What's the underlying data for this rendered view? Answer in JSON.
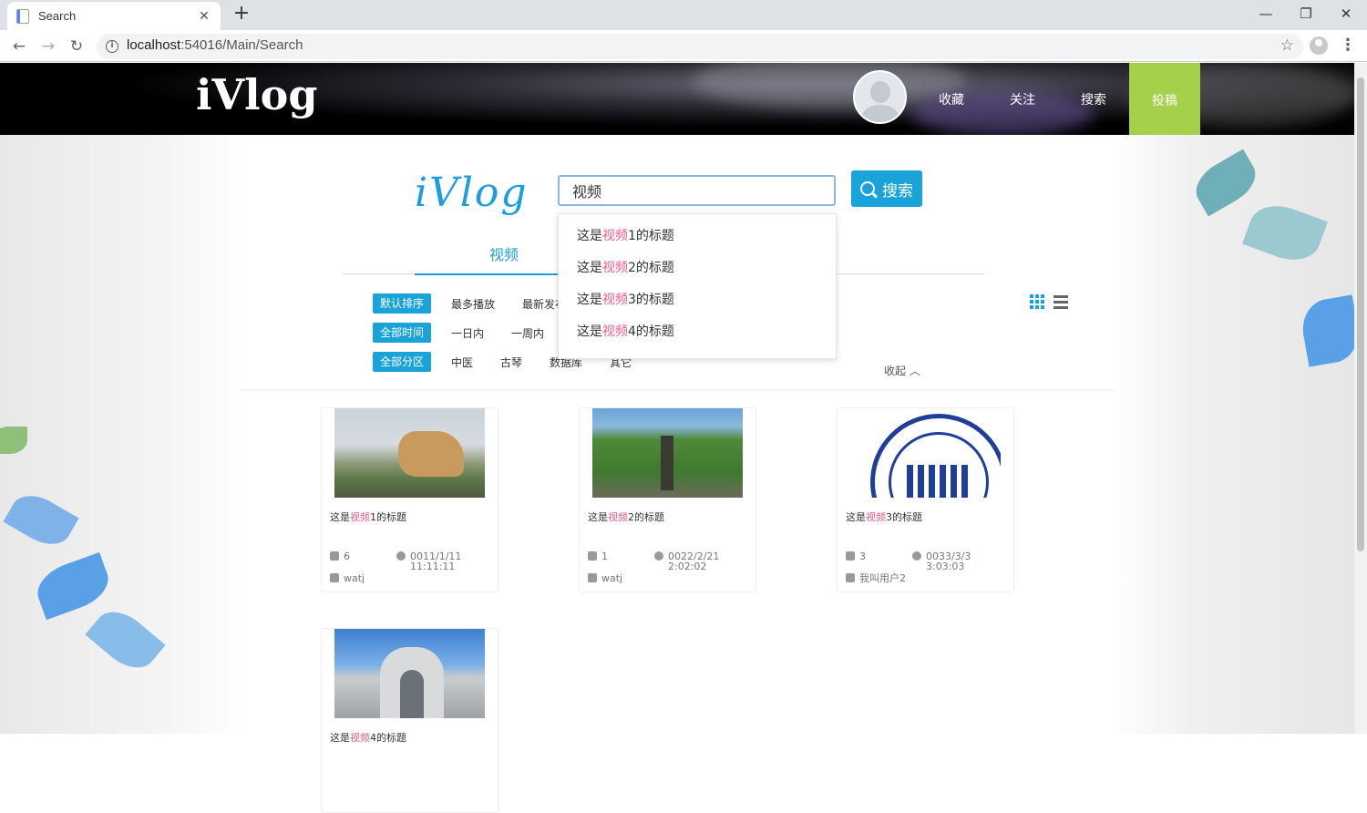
{
  "browser": {
    "tab_title": "Search",
    "tab_close": "✕",
    "new_tab": "+",
    "url_host": "localhost",
    "url_rest": ":54016/Main/Search",
    "win_min": "—",
    "win_max": "❐",
    "win_close": "✕"
  },
  "header": {
    "logo": "iVlog",
    "nav": [
      "收藏",
      "关注",
      "搜索"
    ],
    "submit": "投稿"
  },
  "search": {
    "logo": "iVlog",
    "query": "视频",
    "button": "搜索",
    "suggestions": [
      {
        "pre": "这是",
        "hl": "视频",
        "post": "1的标题"
      },
      {
        "pre": "这是",
        "hl": "视频",
        "post": "2的标题"
      },
      {
        "pre": "这是",
        "hl": "视频",
        "post": "3的标题"
      },
      {
        "pre": "这是",
        "hl": "视频",
        "post": "4的标题"
      }
    ]
  },
  "tabs": {
    "video": "视频"
  },
  "filters": {
    "sort": {
      "active": "默认排序",
      "options": [
        "最多播放",
        "最新发布"
      ]
    },
    "time": {
      "active": "全部时间",
      "options": [
        "一日内",
        "一周内"
      ]
    },
    "zone": {
      "active": "全部分区",
      "options": [
        "中医",
        "古琴",
        "数据库",
        "其它"
      ]
    },
    "collapse": "收起"
  },
  "results": [
    {
      "pre": "这是",
      "hl": "视频",
      "post": "1的标题",
      "plays": "6",
      "date": "0011/1/11",
      "time": "11:11:11",
      "author": "watj"
    },
    {
      "pre": "这是",
      "hl": "视频",
      "post": "2的标题",
      "plays": "1",
      "date": "0022/2/21",
      "time": "2:02:02",
      "author": "watj"
    },
    {
      "pre": "这是",
      "hl": "视频",
      "post": "3的标题",
      "plays": "3",
      "date": "0033/3/3",
      "time": "3:03:03",
      "author": "我叫用户2"
    },
    {
      "pre": "这是",
      "hl": "视频",
      "post": "4的标题"
    }
  ],
  "colors": {
    "accent": "#1aa3d9",
    "highlight": "#ea5b87",
    "submit_bg": "#a6cf4a"
  }
}
